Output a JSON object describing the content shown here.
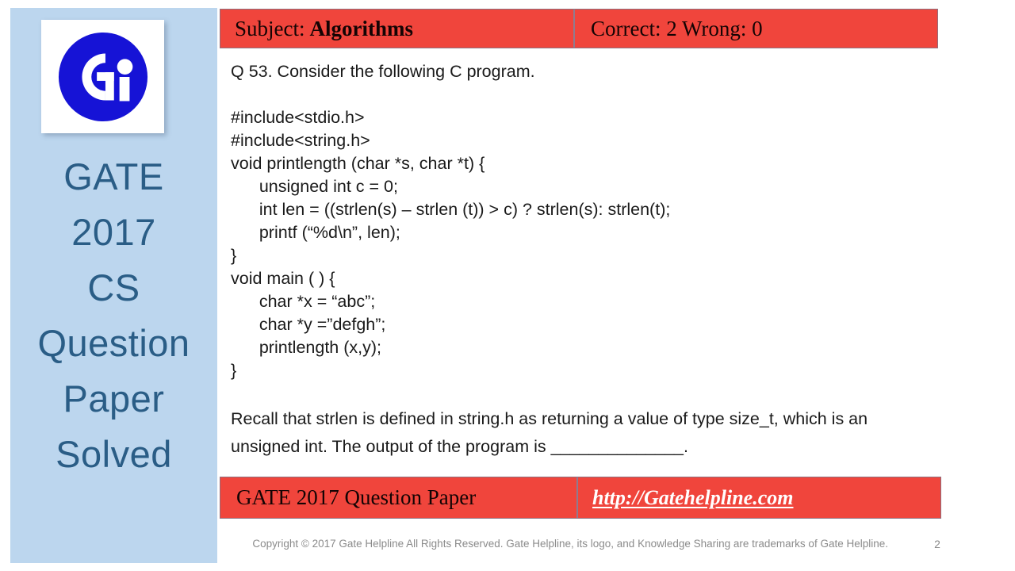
{
  "sidebar": {
    "logo": {
      "icon_name": "gate-helpline-gi-logo",
      "circle_color": "#1613d6",
      "letter_color": "#ffffff",
      "background": "#ffffff"
    },
    "title_lines": [
      "GATE",
      "2017",
      "CS",
      "Question",
      "Paper",
      "Solved"
    ],
    "background_color": "#bcd6ee",
    "text_color": "#2a5d86"
  },
  "header": {
    "subject_label": "Subject:",
    "subject_value": "Algorithms",
    "score_text": "Correct: 2  Wrong: 0",
    "background_color": "#f0453c",
    "text_color": "#140404"
  },
  "question": {
    "intro": "Q 53. Consider the following C program.",
    "code_lines": [
      "#include<stdio.h>",
      "#include<string.h>",
      "void printlength (char *s, char *t) {",
      "      unsigned int c = 0;",
      "      int len = ((strlen(s) – strlen (t)) > c) ? strlen(s): strlen(t);",
      "      printf (“%d\\n”, len);",
      "}",
      "void main ( ) {",
      "      char *x = “abc”;",
      "      char *y =”defgh”;",
      "      printlength (x,y);",
      "}"
    ],
    "recall_text": "Recall that strlen is defined in string.h as returning a value of type size_t, which is an unsigned int. The output of the program is ______________."
  },
  "footer": {
    "title": "GATE 2017 Question Paper",
    "url": "http://Gatehelpline.com",
    "background_color": "#f0453c",
    "url_color": "#ffffff"
  },
  "copyright": {
    "text": "Copyright © 2017 Gate Helpline  All Rights Reserved. Gate Helpline, its logo, and Knowledge Sharing are trademarks of Gate Helpline.",
    "page_number": "2",
    "text_color": "#8b8b8b"
  }
}
